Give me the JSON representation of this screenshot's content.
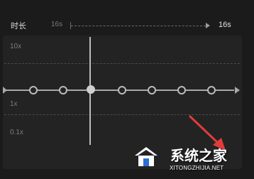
{
  "duration": {
    "label": "时长",
    "start_value": "16s",
    "end_value": "16s"
  },
  "speed_axis": {
    "labels": [
      "10x",
      "1x",
      "0.1x"
    ]
  },
  "curve": {
    "control_points": 7,
    "selected_point_index": 1
  },
  "watermark": {
    "title": "系统之家",
    "url": "XITONGZHIJIA.NET"
  },
  "colors": {
    "background": "#1b1b1b",
    "panel": "#232323",
    "curve": "#a8a8a8",
    "annotation_arrow": "#e23b3b"
  },
  "icons": {
    "curve_start": "triangle-right-icon",
    "curve_end": "triangle-right-icon",
    "duration_end": "triangle-right-icon",
    "annotation": "red-arrow-icon",
    "watermark_logo": "house-logo-icon"
  }
}
